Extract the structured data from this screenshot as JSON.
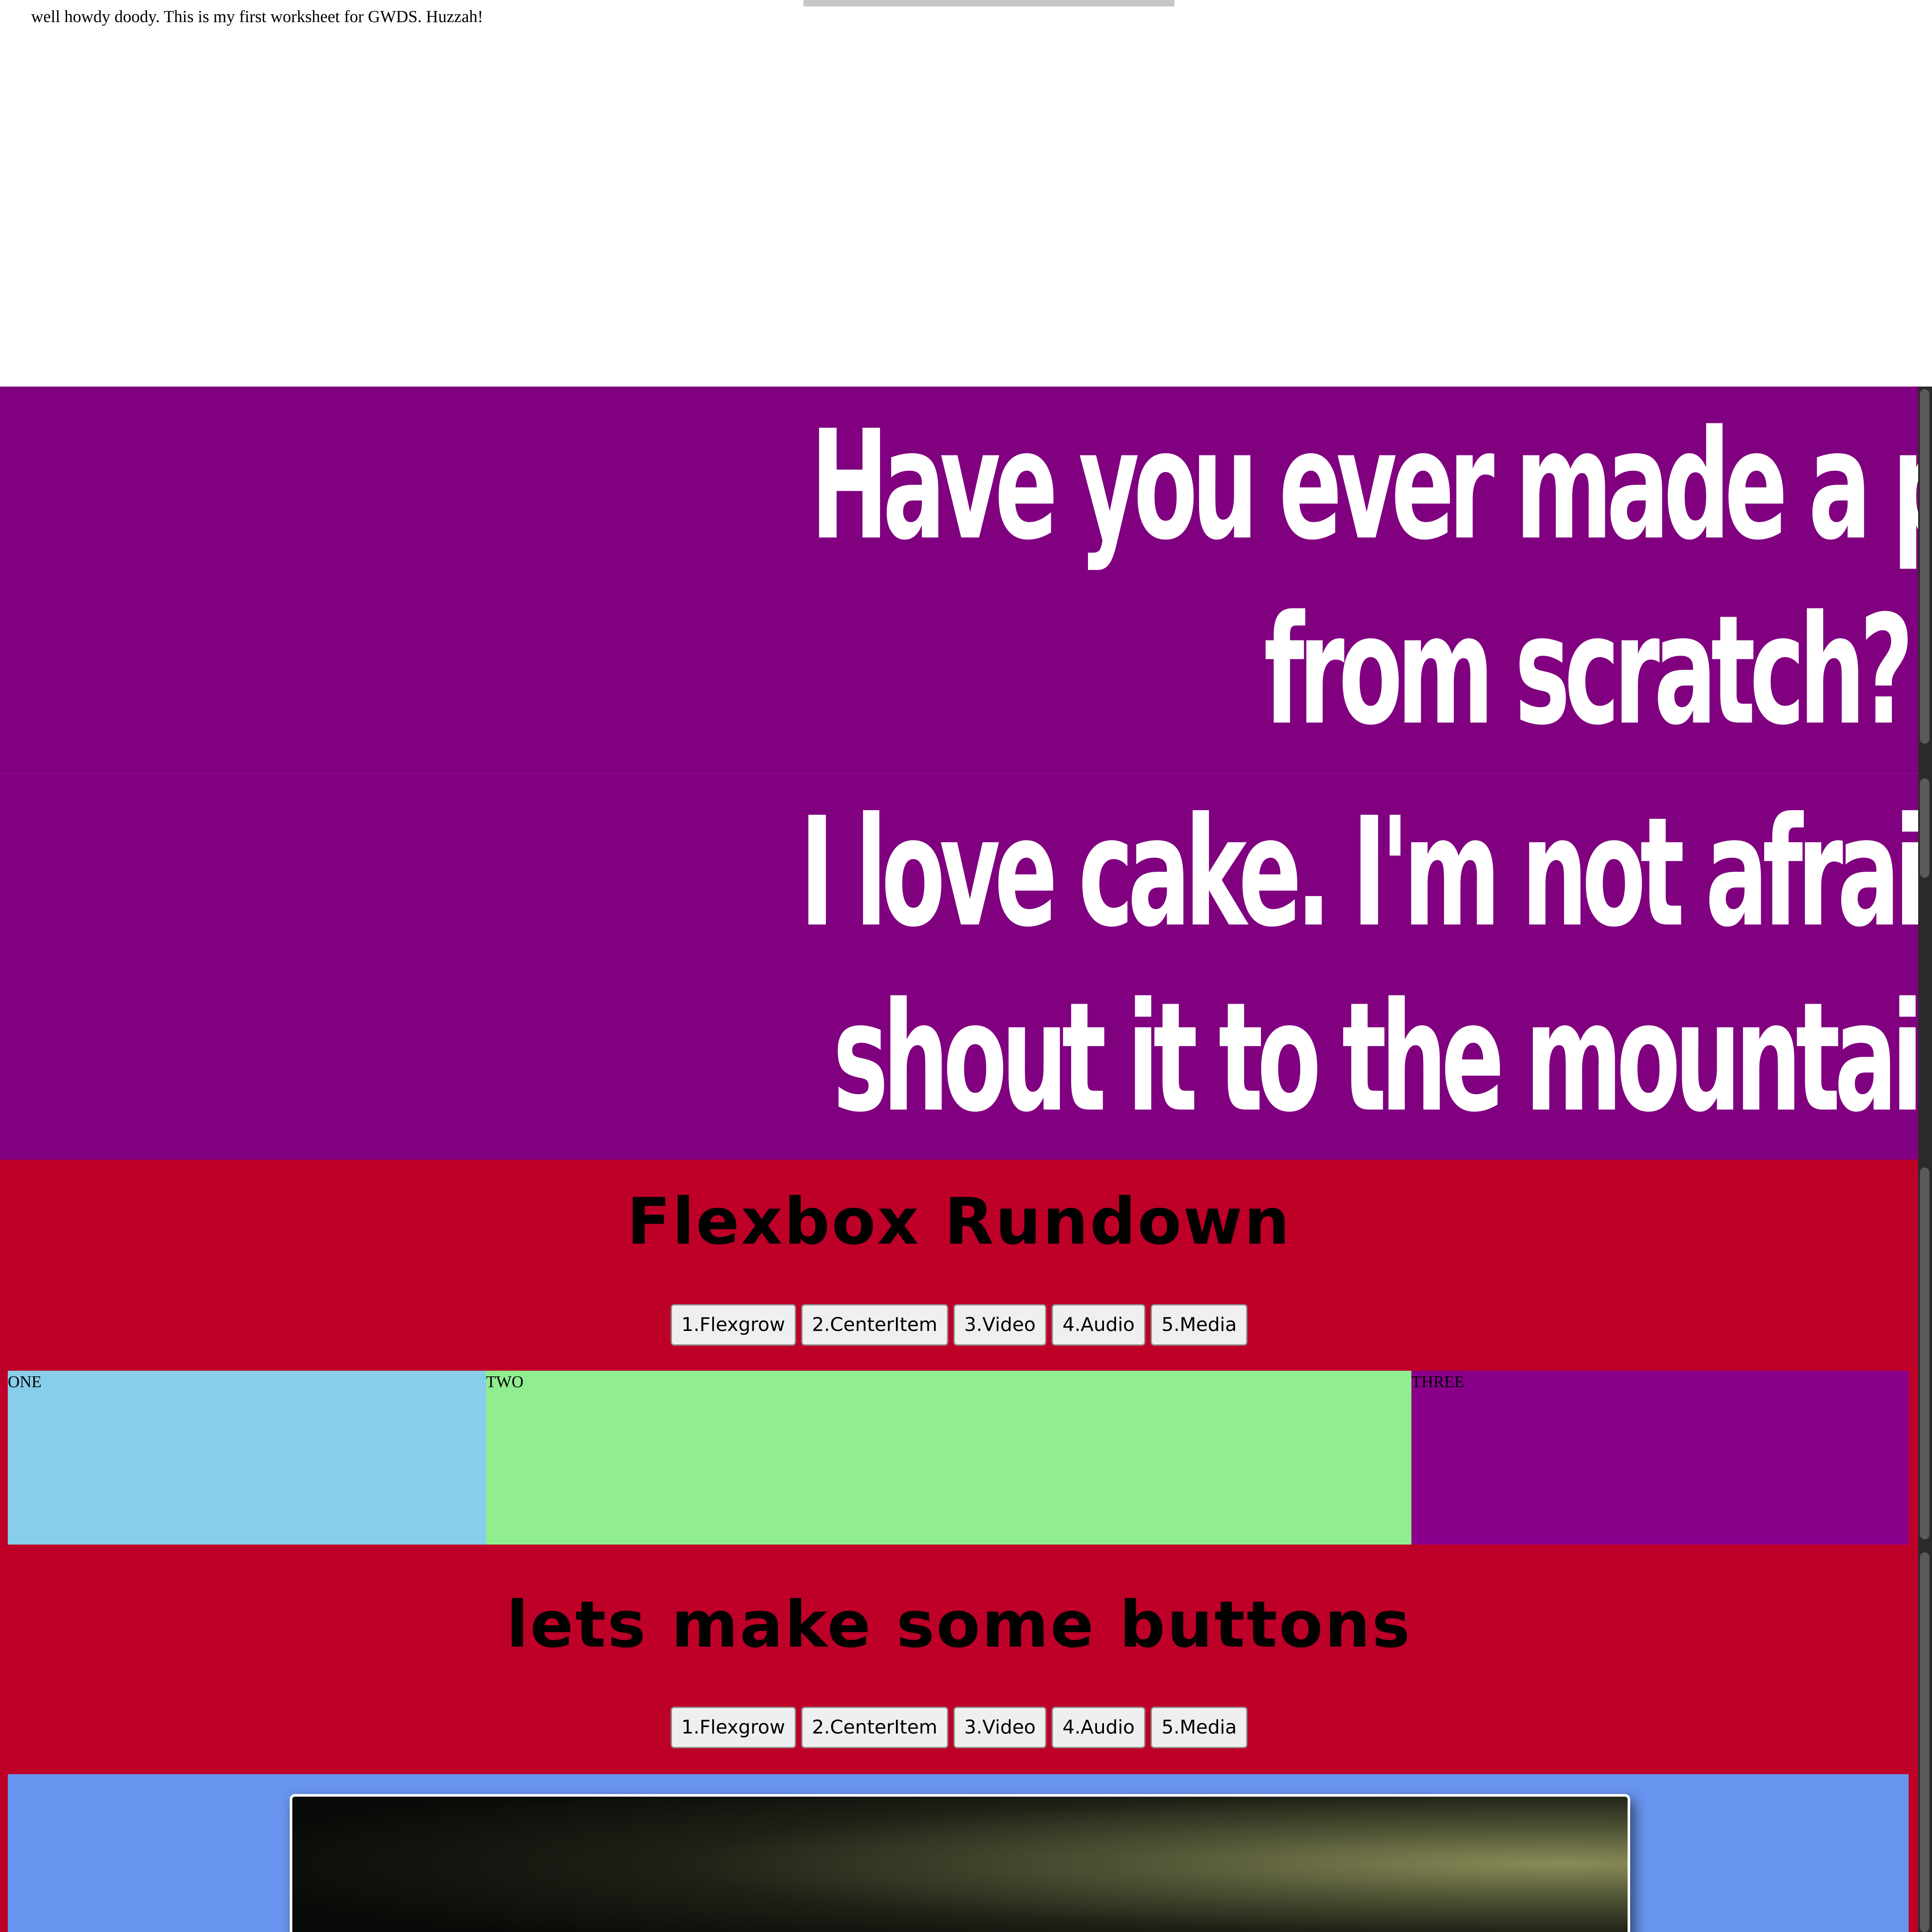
{
  "intro": {
    "text": "well howdy doody. This is my first worksheet for GWDS. Huzzah!"
  },
  "hero": [
    {
      "line1": "Have you ever made a pizza",
      "line2": "from scratch?"
    },
    {
      "line1": "I love cake. I'm not afraid to",
      "line2": "shout it to the mountain top."
    }
  ],
  "sections": [
    {
      "title": "Flexbox Rundown",
      "buttons": [
        "1.Flexgrow",
        "2.CenterItem",
        "3.Video",
        "4.Audio",
        "5.Media"
      ]
    },
    {
      "title": "lets make some buttons",
      "buttons": [
        "1.Flexgrow",
        "2.CenterItem",
        "3.Video",
        "4.Audio",
        "5.Media"
      ]
    }
  ],
  "flex_items": [
    "ONE",
    "TWO",
    "THREE"
  ],
  "colors": {
    "hero_bg": "#800080",
    "section_bg": "#be0028",
    "flex_one": "#87ceeb",
    "flex_two": "#90ee90",
    "flex_three": "#8b008b",
    "media_bg": "#6895ef"
  }
}
